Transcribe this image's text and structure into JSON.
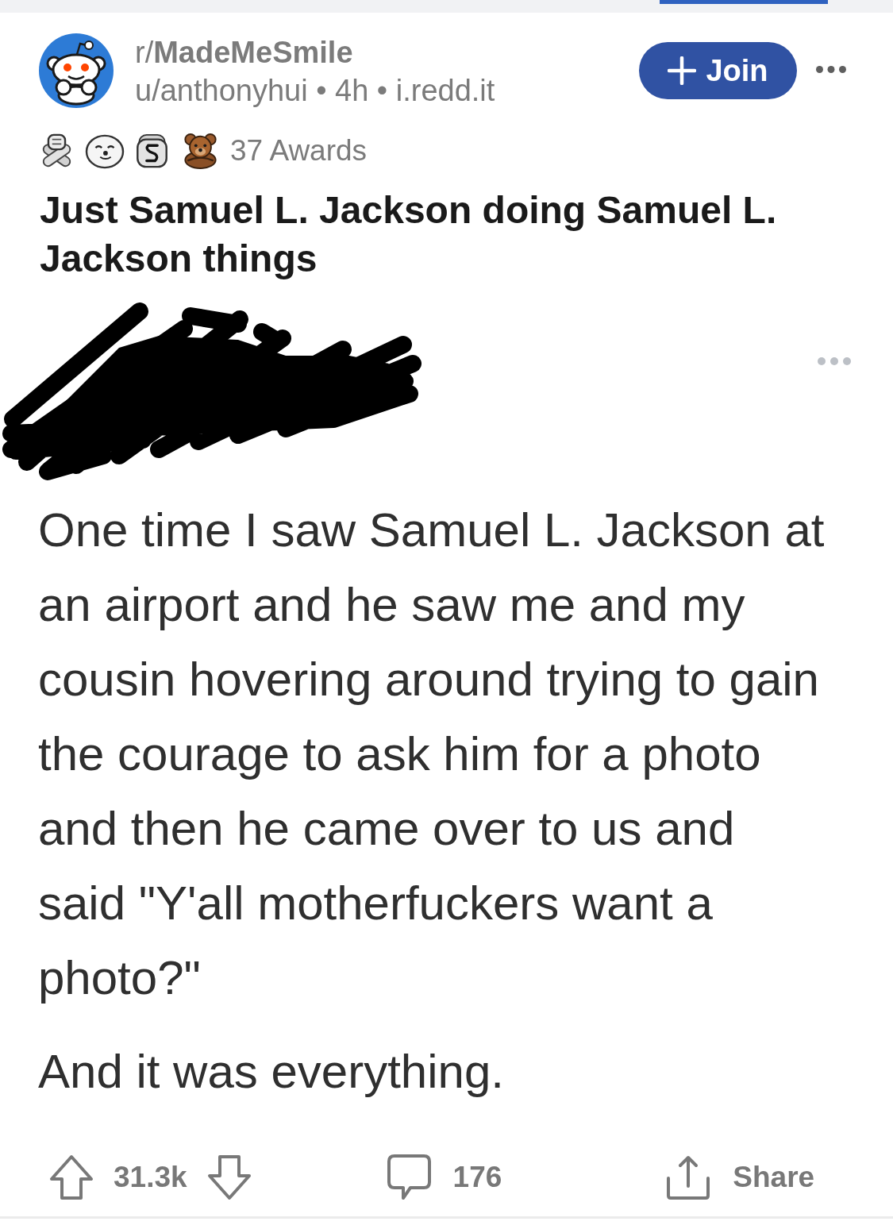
{
  "post": {
    "subreddit": "r/**MadeMeSmile**",
    "meta": "u/anthonyhui • 4h • i.redd.it",
    "join_label": "Join",
    "awards_label": "37 Awards",
    "title": "Just Samuel L. Jackson doing Samuel L. Jackson things"
  },
  "image": {
    "paragraphs": [
      {
        "lines": [
          "One time I saw Samuel L. Jackson at",
          "an airport and he saw me and my",
          "cousin hovering around trying to gain",
          "the courage to ask him for a photo",
          "and then he came over to us and",
          "said \"Y'all motherfuckers want a",
          "photo?\""
        ]
      },
      {
        "lines": [
          "And it was everything."
        ]
      }
    ]
  },
  "actions": {
    "score": "31.3k",
    "comments": "176",
    "share": "Share"
  }
}
